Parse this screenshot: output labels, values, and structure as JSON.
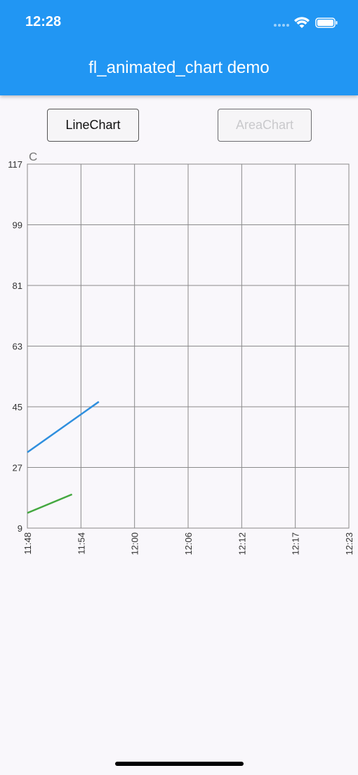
{
  "status_bar": {
    "time": "12:28",
    "icons": [
      "signal-dots-icon",
      "wifi-icon",
      "battery-icon"
    ]
  },
  "app_bar": {
    "title": "fl_animated_chart demo",
    "color": "#2196f3"
  },
  "buttons": [
    {
      "label": "LineChart",
      "enabled": true
    },
    {
      "label": "AreaChart",
      "enabled": false
    }
  ],
  "chart_data": {
    "type": "line",
    "ylabel": "C",
    "ylim": [
      9,
      117
    ],
    "y_ticks": [
      9,
      27,
      45,
      63,
      81,
      99,
      117
    ],
    "x_ticks": [
      "11:48",
      "11:54",
      "12:00",
      "12:06",
      "12:12",
      "12:17",
      "12:23"
    ],
    "grid": true,
    "series": [
      {
        "color": "#2f8fde",
        "points": [
          [
            "11:48",
            31.5
          ],
          [
            "11:56",
            46.5
          ]
        ]
      },
      {
        "color": "#44a840",
        "points": [
          [
            "11:48",
            13.5
          ],
          [
            "11:53",
            19
          ]
        ]
      }
    ]
  }
}
